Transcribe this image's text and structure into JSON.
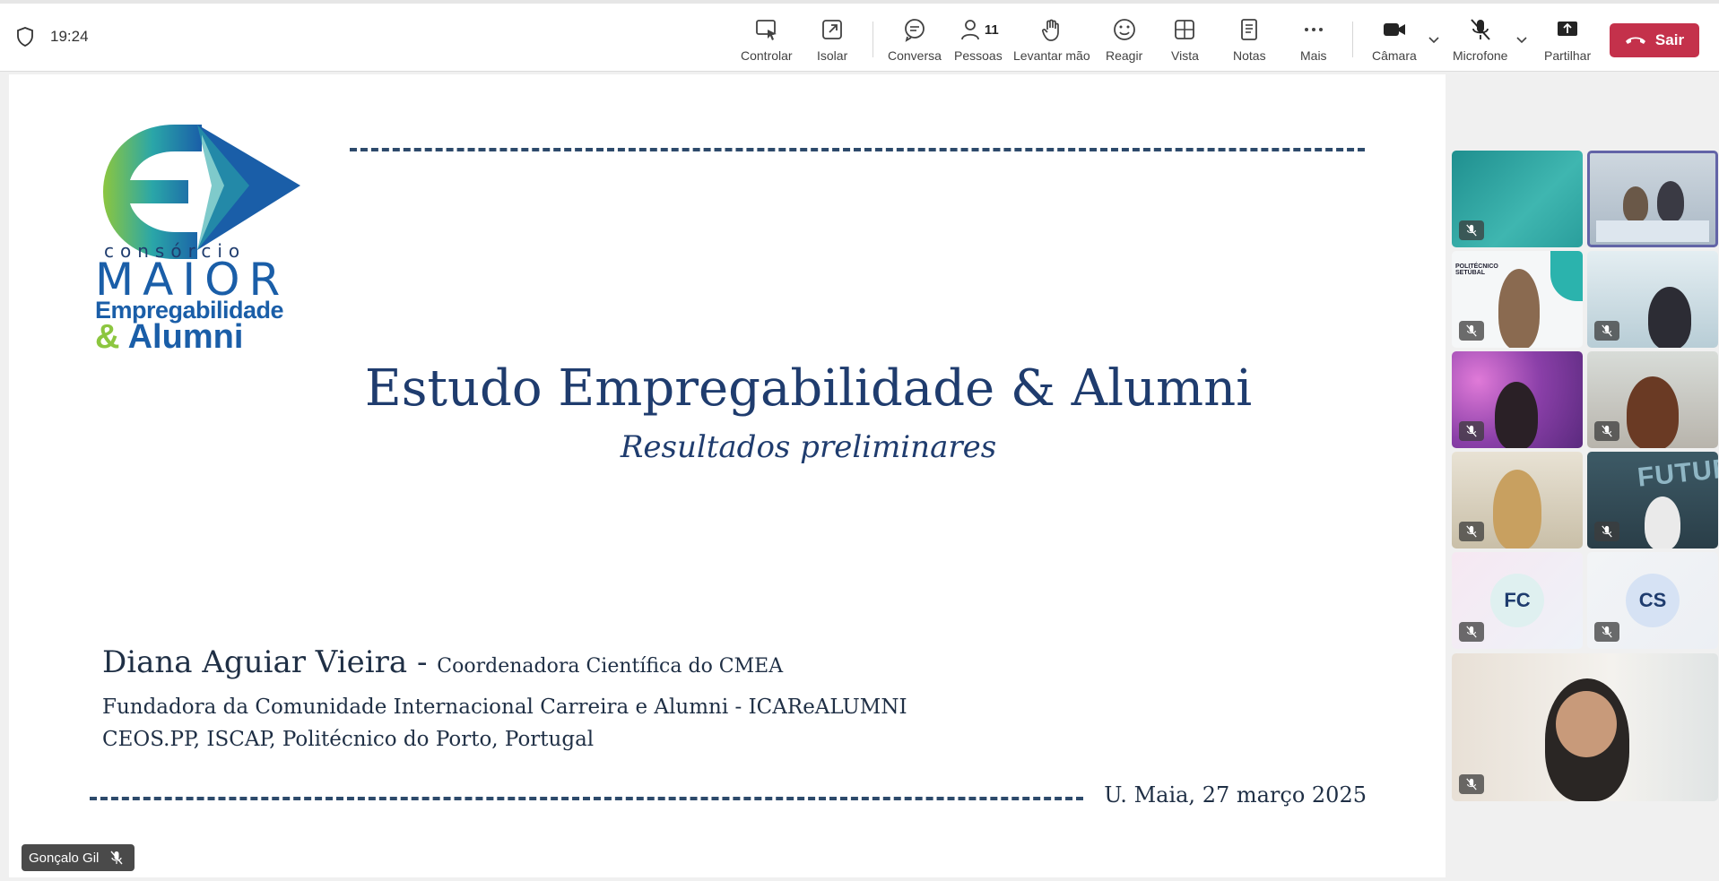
{
  "topbar": {
    "time": "19:24",
    "controls": {
      "control": "Controlar",
      "isolate": "Isolar",
      "chat": "Conversa",
      "people": "Pessoas",
      "people_count": "11",
      "raise_hand": "Levantar mão",
      "react": "Reagir",
      "view": "Vista",
      "notes": "Notas",
      "more": "Mais",
      "camera": "Câmara",
      "mic": "Microfone",
      "share": "Partilhar",
      "leave": "Sair"
    },
    "colors": {
      "leave": "#c4314b",
      "active_outline": "#6264a7"
    }
  },
  "slide": {
    "logo": {
      "line1": "consórcio",
      "line2": "MAIOR",
      "line3": "Empregabilidade",
      "line4_amp": "&",
      "line4": "Alumni"
    },
    "title": "Estudo Empregabilidade & Alumni",
    "subtitle": "Resultados preliminares",
    "author_name": "Diana Aguiar Vieira - ",
    "author_role": "Coordenadora Científica do CMEA",
    "affiliation_1": "Fundadora da Comunidade Internacional Carreira e Alumni - ICAReALUMNI",
    "affiliation_2": "CEOS.PP, ISCAP, Politécnico do Porto, Portugal",
    "date": "U. Maia, 27 março 2025",
    "colors": {
      "navy": "#1f3c6e",
      "green": "#8cc63f",
      "blue": "#1a5ea8"
    }
  },
  "presenter": {
    "name": "Gonçalo Gil"
  },
  "participants": {
    "tile_fc_initials": "FC",
    "tile_cs_initials": "CS",
    "tile_pt_label1": "POLITÉCNICO",
    "tile_pt_label2": "SETÚBAL",
    "tile_futuro_text": "FUTURO"
  }
}
